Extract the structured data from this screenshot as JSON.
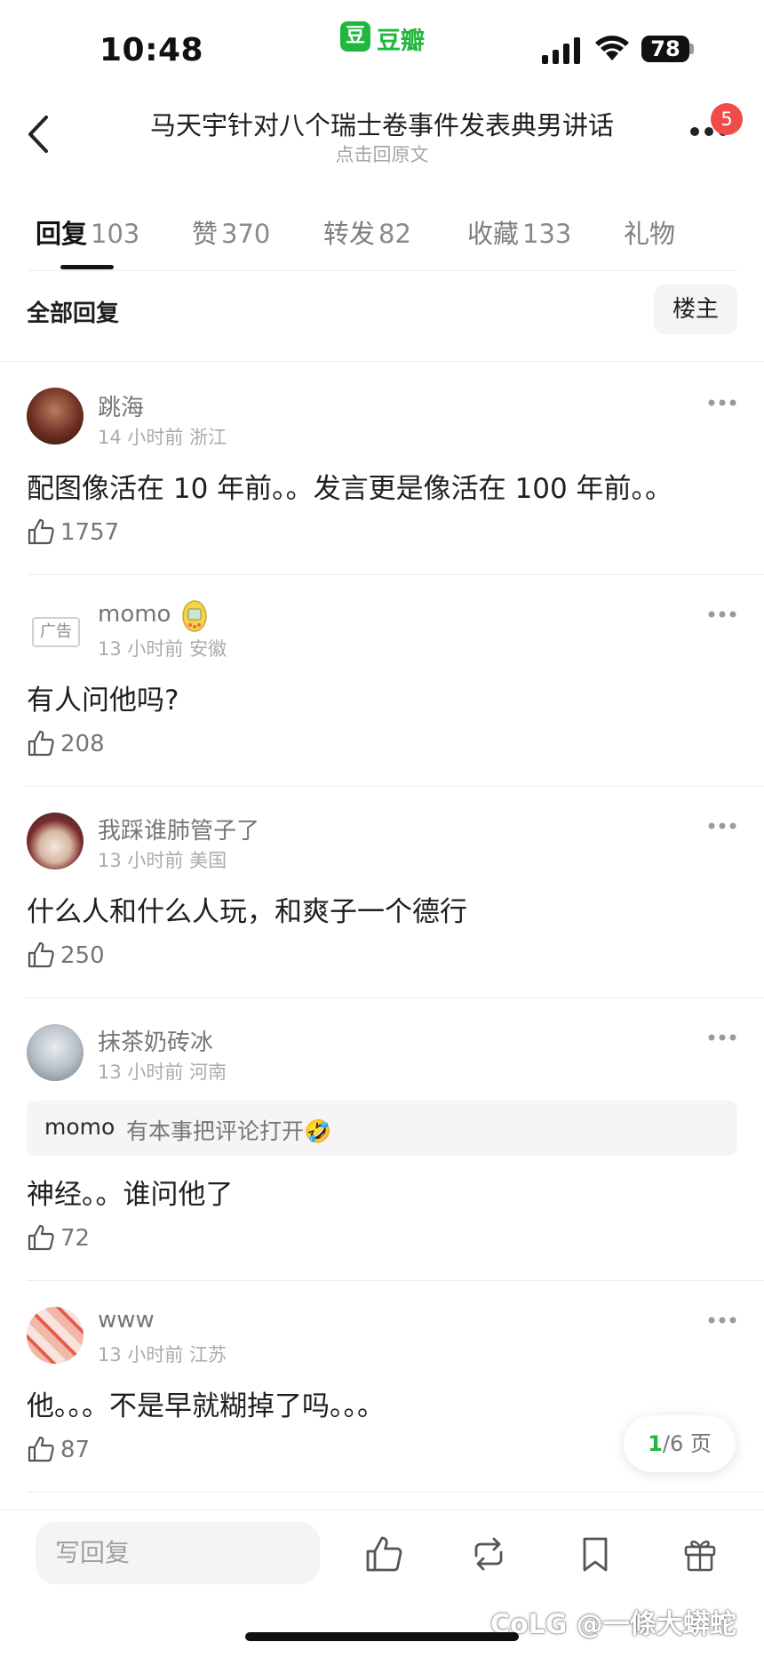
{
  "status_bar": {
    "time": "10:48",
    "app_badge": "豆",
    "app_name": "豆瓣",
    "battery": "78"
  },
  "header": {
    "title": "马天宇针对八个瑞士卷事件发表典男讲话",
    "subtitle": "点击回原文",
    "notification_count": "5"
  },
  "tabs": [
    {
      "label": "回复",
      "count": "103",
      "active": true
    },
    {
      "label": "赞",
      "count": "370"
    },
    {
      "label": "转发",
      "count": "82"
    },
    {
      "label": "收藏",
      "count": "133"
    },
    {
      "label": "礼物",
      "count": ""
    }
  ],
  "filter": {
    "all_replies": "全部回复",
    "owner_only": "楼主"
  },
  "comments": [
    {
      "user": "跳海",
      "meta": "14 小时前 浙江",
      "text": "配图像活在 10 年前。。发言更是像活在 100 年前。。",
      "likes": "1757"
    },
    {
      "user": "momo",
      "meta": "13 小时前 安徽",
      "text": "有人问他吗?",
      "likes": "208",
      "ad_label": "广告"
    },
    {
      "user": "我踩谁肺管子了",
      "meta": "13 小时前 美国",
      "text": "什么人和什么人玩，和爽子一个德行",
      "likes": "250"
    },
    {
      "user": "抹茶奶砖冰",
      "meta": "13 小时前 河南",
      "quote_user": "momo",
      "quote_text": "有本事把评论打开🤣",
      "text": "神经。。谁问他了",
      "likes": "72"
    },
    {
      "user": "www",
      "meta": "13 小时前 江苏",
      "text": "他。。。不是早就糊掉了吗。。。",
      "likes": "87"
    }
  ],
  "pager": {
    "current": "1",
    "total": "/6 页"
  },
  "bottom_bar": {
    "reply_placeholder": "写回复"
  },
  "watermark": "CoLG @一條大蟒蛇",
  "colors": {
    "brand_green": "#1fb83d",
    "badge_red": "#f04a4a"
  },
  "icons": [
    "back-icon",
    "more-icon",
    "thumb-up-icon",
    "repost-icon",
    "bookmark-icon",
    "gift-icon",
    "signal-icon",
    "wifi-icon"
  ]
}
